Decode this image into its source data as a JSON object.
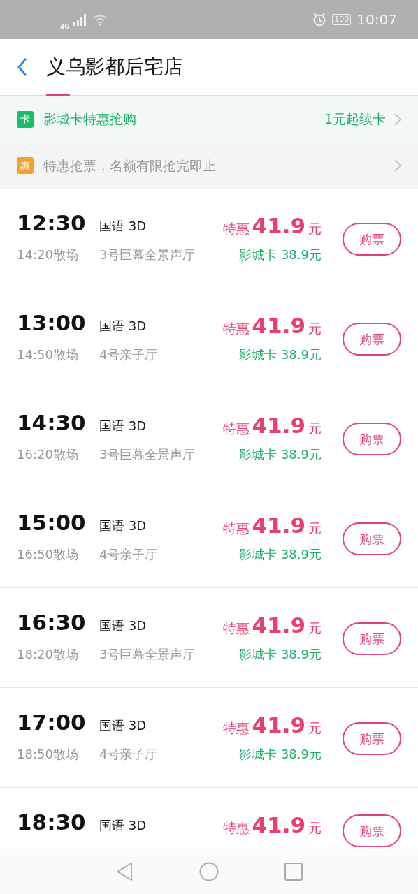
{
  "status_bar": {
    "network": "4G",
    "battery": "100",
    "time": "10:07"
  },
  "header": {
    "title": "义乌影都后宅店"
  },
  "banners": [
    {
      "kind": "card",
      "badge": "卡",
      "text": "影城卡特惠抢购",
      "action": "1元起续卡"
    },
    {
      "kind": "promo",
      "badge": "惠",
      "text": "特惠抢票，名额有限抢完即止"
    }
  ],
  "showtimes": [
    {
      "start": "12:30",
      "language": "国语 3D",
      "price_label": "特惠",
      "price": "41.9",
      "unit": "元",
      "end": "14:20散场",
      "hall": "3号巨幕全景声厅",
      "card_price": "影城卡 38.9元",
      "button": "购票"
    },
    {
      "start": "13:00",
      "language": "国语 3D",
      "price_label": "特惠",
      "price": "41.9",
      "unit": "元",
      "end": "14:50散场",
      "hall": "4号亲子厅",
      "card_price": "影城卡 38.9元",
      "button": "购票"
    },
    {
      "start": "14:30",
      "language": "国语 3D",
      "price_label": "特惠",
      "price": "41.9",
      "unit": "元",
      "end": "16:20散场",
      "hall": "3号巨幕全景声厅",
      "card_price": "影城卡 38.9元",
      "button": "购票"
    },
    {
      "start": "15:00",
      "language": "国语 3D",
      "price_label": "特惠",
      "price": "41.9",
      "unit": "元",
      "end": "16:50散场",
      "hall": "4号亲子厅",
      "card_price": "影城卡 38.9元",
      "button": "购票"
    },
    {
      "start": "16:30",
      "language": "国语 3D",
      "price_label": "特惠",
      "price": "41.9",
      "unit": "元",
      "end": "18:20散场",
      "hall": "3号巨幕全景声厅",
      "card_price": "影城卡 38.9元",
      "button": "购票"
    },
    {
      "start": "17:00",
      "language": "国语 3D",
      "price_label": "特惠",
      "price": "41.9",
      "unit": "元",
      "end": "18:50散场",
      "hall": "4号亲子厅",
      "card_price": "影城卡 38.9元",
      "button": "购票"
    },
    {
      "start": "18:30",
      "language": "国语 3D",
      "price_label": "特惠",
      "price": "41.9",
      "unit": "元",
      "button": "购票"
    }
  ]
}
